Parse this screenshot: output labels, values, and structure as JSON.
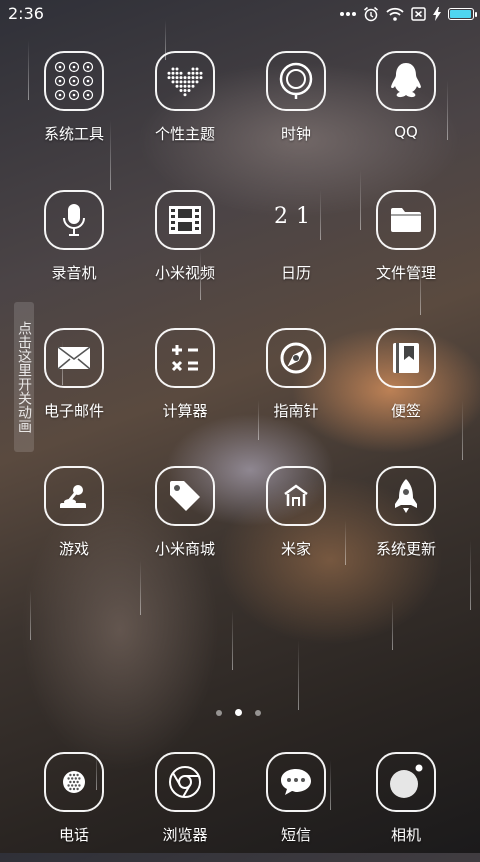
{
  "status_bar": {
    "time": "2:36",
    "battery_level": 0.95,
    "icons": [
      "more-dots-icon",
      "alarm-icon",
      "wifi-icon",
      "no-sim-icon",
      "charging-icon",
      "battery-icon"
    ]
  },
  "apps": [
    {
      "label": "系统工具",
      "icon": "app-folder-icon"
    },
    {
      "label": "个性主题",
      "icon": "heart-icon"
    },
    {
      "label": "时钟",
      "icon": "clock-icon"
    },
    {
      "label": "QQ",
      "icon": "penguin-icon"
    },
    {
      "label": "录音机",
      "icon": "microphone-icon"
    },
    {
      "label": "小米视频",
      "icon": "film-icon"
    },
    {
      "label": "日历",
      "icon": "calendar-icon",
      "date": "21"
    },
    {
      "label": "文件管理",
      "icon": "folder-icon"
    },
    {
      "label": "电子邮件",
      "icon": "envelope-icon"
    },
    {
      "label": "计算器",
      "icon": "calculator-icon"
    },
    {
      "label": "指南针",
      "icon": "compass-icon"
    },
    {
      "label": "便签",
      "icon": "notes-icon"
    },
    {
      "label": "游戏",
      "icon": "joystick-icon"
    },
    {
      "label": "小米商城",
      "icon": "tag-icon"
    },
    {
      "label": "米家",
      "icon": "home-icon"
    },
    {
      "label": "系统更新",
      "icon": "rocket-icon"
    }
  ],
  "side_toggle": {
    "label": "点击这里开关动画"
  },
  "page_indicator": {
    "count": 3,
    "active": 2
  },
  "dock": [
    {
      "label": "电话",
      "icon": "phone-icon"
    },
    {
      "label": "浏览器",
      "icon": "browser-icon"
    },
    {
      "label": "短信",
      "icon": "message-icon"
    },
    {
      "label": "相机",
      "icon": "camera-icon"
    }
  ]
}
